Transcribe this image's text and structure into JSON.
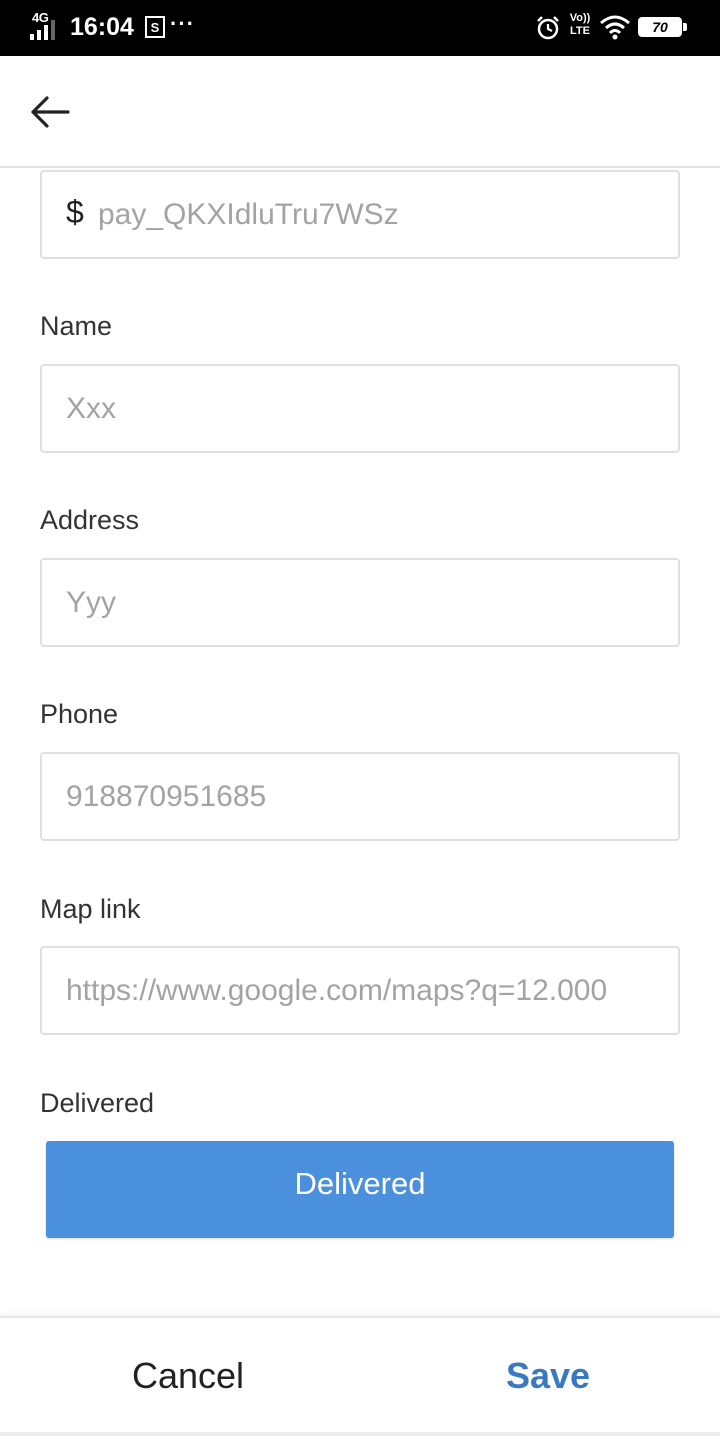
{
  "status_bar": {
    "network": "4G",
    "time": "16:04",
    "more": "···",
    "lte_line1": "Vo))",
    "lte_line2": "LTE",
    "battery": "70",
    "icons": [
      "signal-icon",
      "screenshot-icon",
      "alarm-icon",
      "volte-icon",
      "wifi-icon",
      "battery-icon"
    ]
  },
  "app_bar": {
    "back_icon": "arrow-left-icon"
  },
  "form": {
    "payment": {
      "prefix": "$",
      "value": "pay_QKXIdluTru7WSz"
    },
    "name": {
      "label": "Name",
      "value": "Xxx"
    },
    "address": {
      "label": "Address",
      "value": "Yyy"
    },
    "phone": {
      "label": "Phone",
      "value": "918870951685"
    },
    "map_link": {
      "label": "Map link",
      "value": "https://www.google.com/maps?q=12.000"
    },
    "delivered": {
      "label": "Delivered",
      "button_label": "Delivered",
      "button_color": "#4a90dc"
    }
  },
  "actions": {
    "cancel_label": "Cancel",
    "save_label": "Save",
    "save_color": "#3a78c0"
  }
}
